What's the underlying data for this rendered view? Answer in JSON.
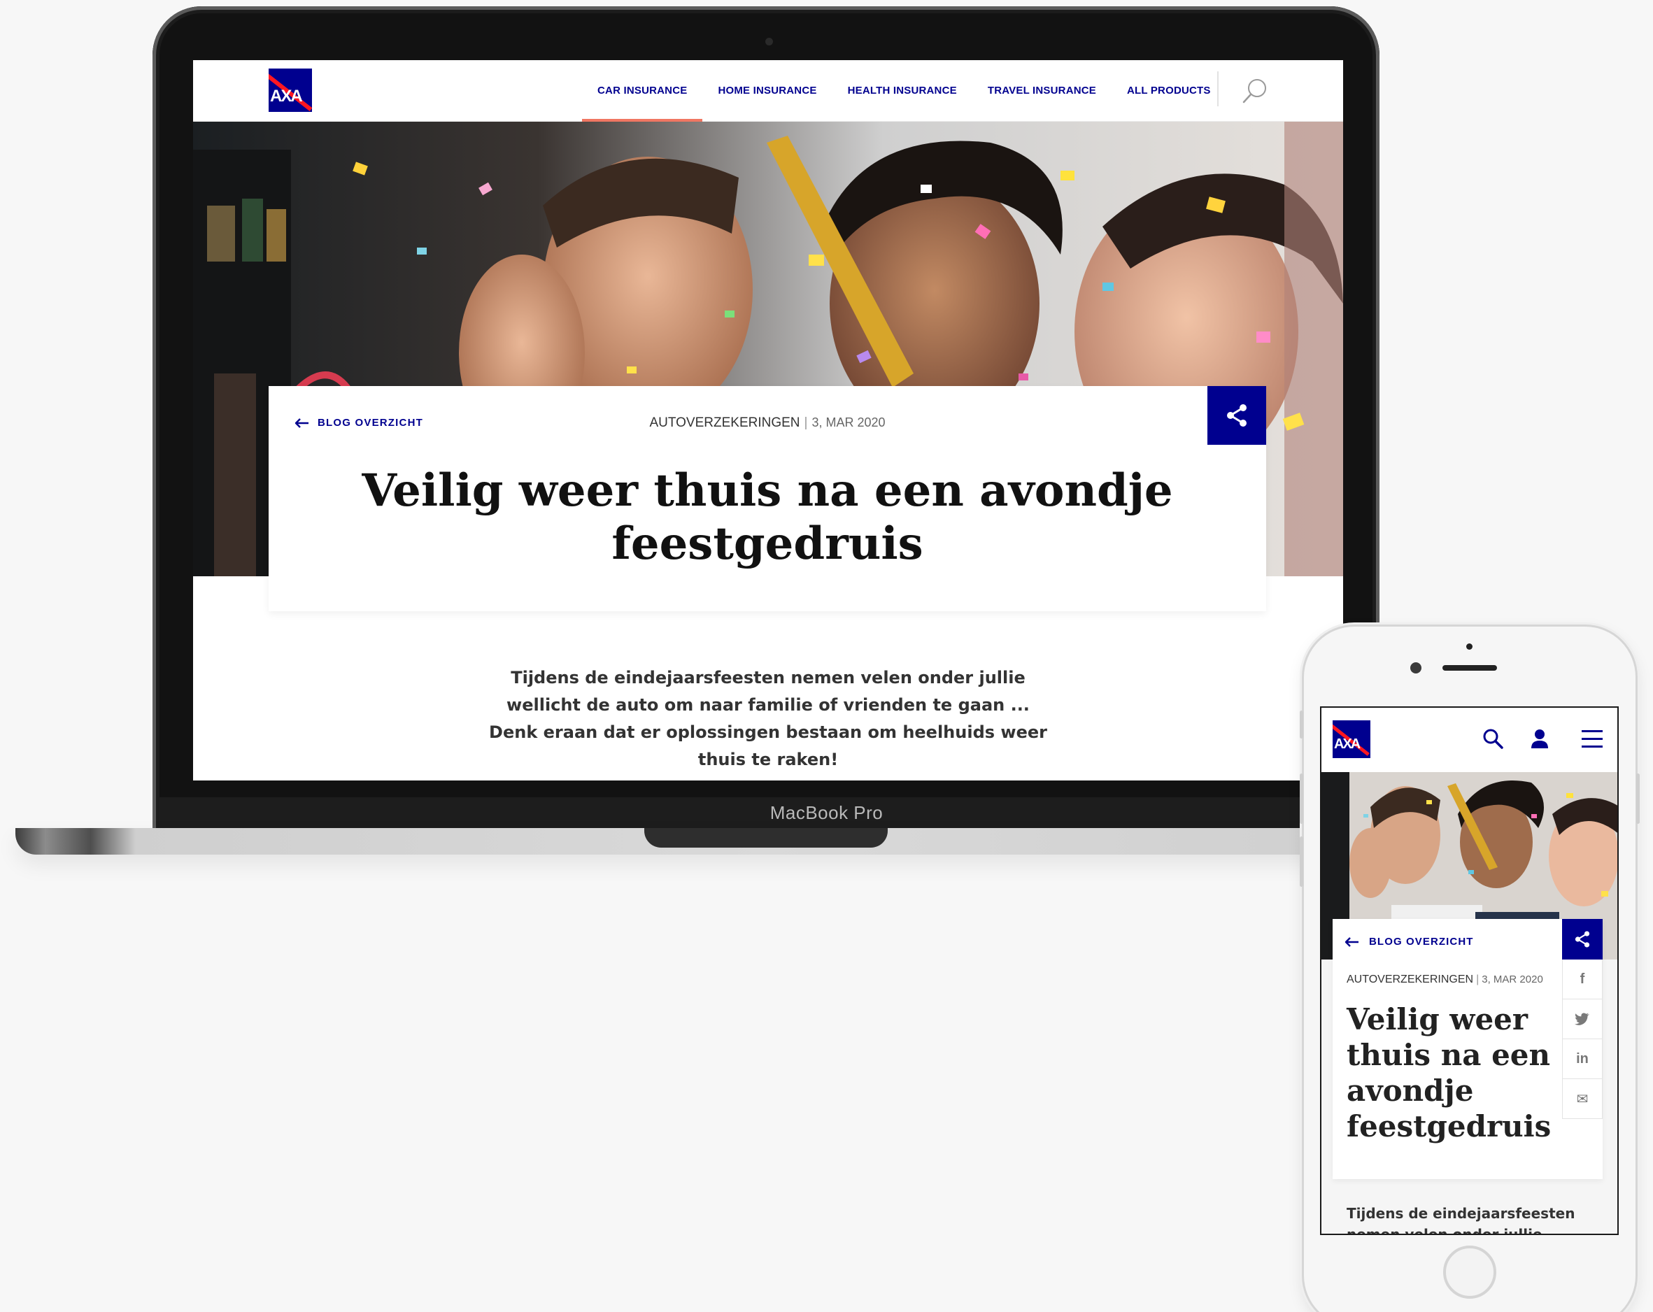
{
  "brand": {
    "logo_text": "AXA",
    "color_primary": "#00008f",
    "color_accent": "#ff1721",
    "color_active_underline": "#f07662"
  },
  "desktop": {
    "nav": [
      {
        "label": "CAR INSURANCE",
        "active": true
      },
      {
        "label": "HOME INSURANCE",
        "active": false
      },
      {
        "label": "HEALTH INSURANCE",
        "active": false
      },
      {
        "label": "TRAVEL INSURANCE",
        "active": false
      },
      {
        "label": "ALL PRODUCTS",
        "active": false
      }
    ],
    "search_icon": "search-icon",
    "hero_image": "party-confetti-photo",
    "back_label": "BLOG OVERZICHT",
    "category": "AUTOVERZEKERINGEN",
    "separator": "|",
    "date": "3, MAR 2020",
    "title": "Veilig weer thuis na een avondje feestgedruis",
    "intro": "Tijdens de eindejaarsfeesten nemen velen onder jullie wellicht de auto om naar familie of vrienden te gaan ... Denk eraan dat er oplossingen bestaan om heelhuids weer thuis te raken!",
    "share_icon": "share-icon"
  },
  "laptop": {
    "label": "MacBook Pro"
  },
  "mobile": {
    "header_icons": [
      "search-icon",
      "user-icon",
      "menu-icon"
    ],
    "back_label": "BLOG OVERZICHT",
    "category": "AUTOVERZEKERINGEN",
    "separator": "|",
    "date": "3, MAR 2020",
    "title": "Veilig weer thuis na een avondje feestgedruis",
    "intro": "Tijdens de eindejaarsfeesten nemen velen onder jullie wellicht de auto",
    "social": [
      {
        "icon": "facebook-icon",
        "glyph": "f"
      },
      {
        "icon": "twitter-icon",
        "glyph": "t"
      },
      {
        "icon": "linkedin-icon",
        "glyph": "in"
      },
      {
        "icon": "mail-icon",
        "glyph": "✉"
      }
    ]
  }
}
